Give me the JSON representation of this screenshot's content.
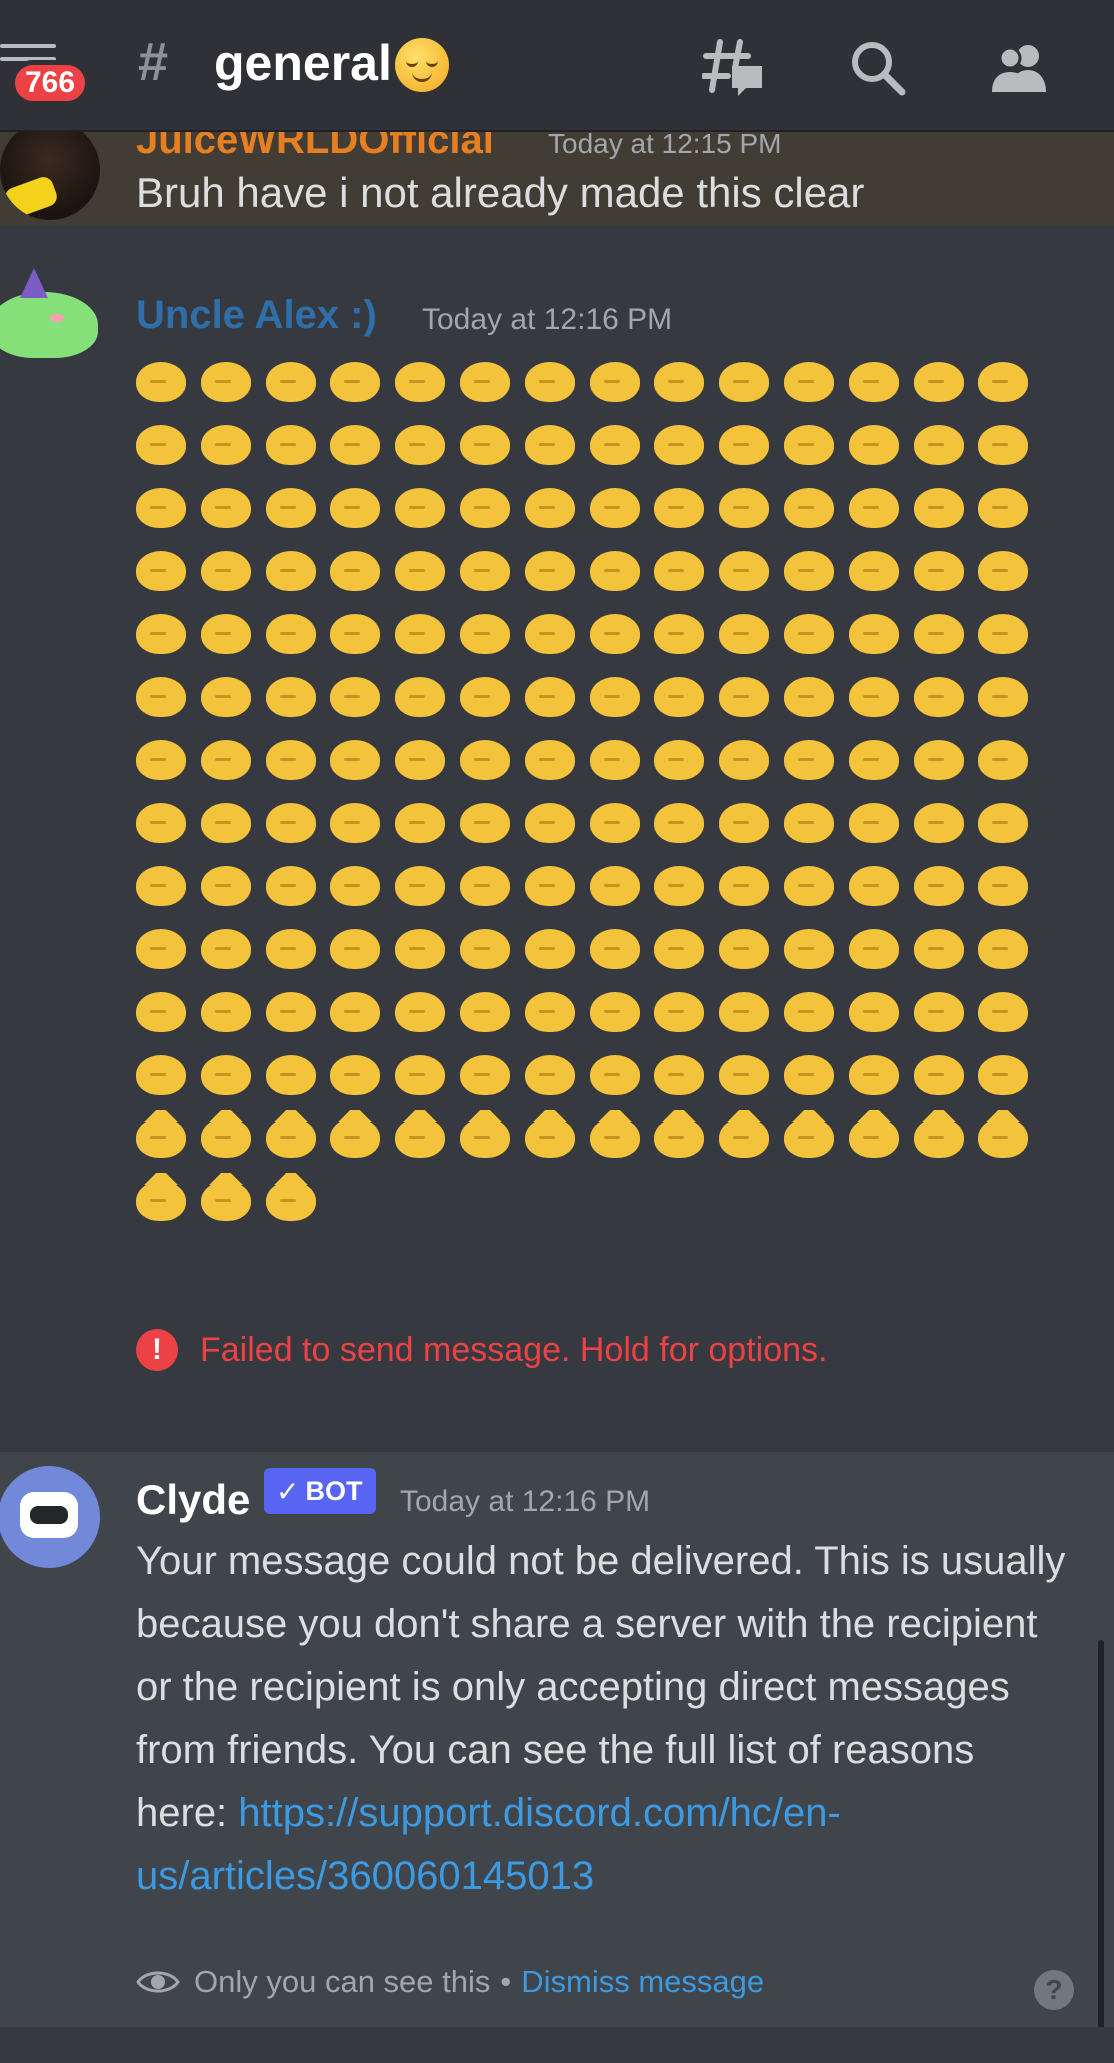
{
  "header": {
    "unread_badge": "766",
    "hash": "#",
    "channel_name": "general",
    "channel_emoji": "relieved-face",
    "icons": [
      "threads-icon",
      "search-icon",
      "members-icon"
    ]
  },
  "messages": {
    "first": {
      "author": "JuiceWRLDOfficial",
      "time": "Today at 12:15 PM",
      "text": "Bruh have i not already made this clear"
    },
    "alex": {
      "author": "Uncle Alex :)",
      "time": "Today at 12:16 PM",
      "emoji_count": 185,
      "emoji_description": "blob emoji",
      "failed_icon": "!",
      "failed_text": "Failed to send message. Hold for options."
    },
    "clyde": {
      "author": "Clyde",
      "bot_check": "✓",
      "bot_tag": "BOT",
      "time": "Today at 12:16 PM",
      "text": "Your message could not be delivered. This is usually because you don't share a server with the recipient or the recipient is only accepting direct messages from friends. You can see the full list of reasons here: ",
      "link": "https://support.discord.com/hc/en-us/articles/360060145013",
      "ephemeral_text": "Only you can see this",
      "separator": "•",
      "dismiss": "Dismiss message",
      "help": "?"
    }
  },
  "colors": {
    "background": "#36393f",
    "header": "#2f3136",
    "badge": "#ed4245",
    "error": "#ed4245",
    "link": "#3b9ae1",
    "bot_tag": "#5865f2",
    "alex_name": "#2f6ea8",
    "juice_name": "#e67e22",
    "emoji": "#f3c33c"
  }
}
